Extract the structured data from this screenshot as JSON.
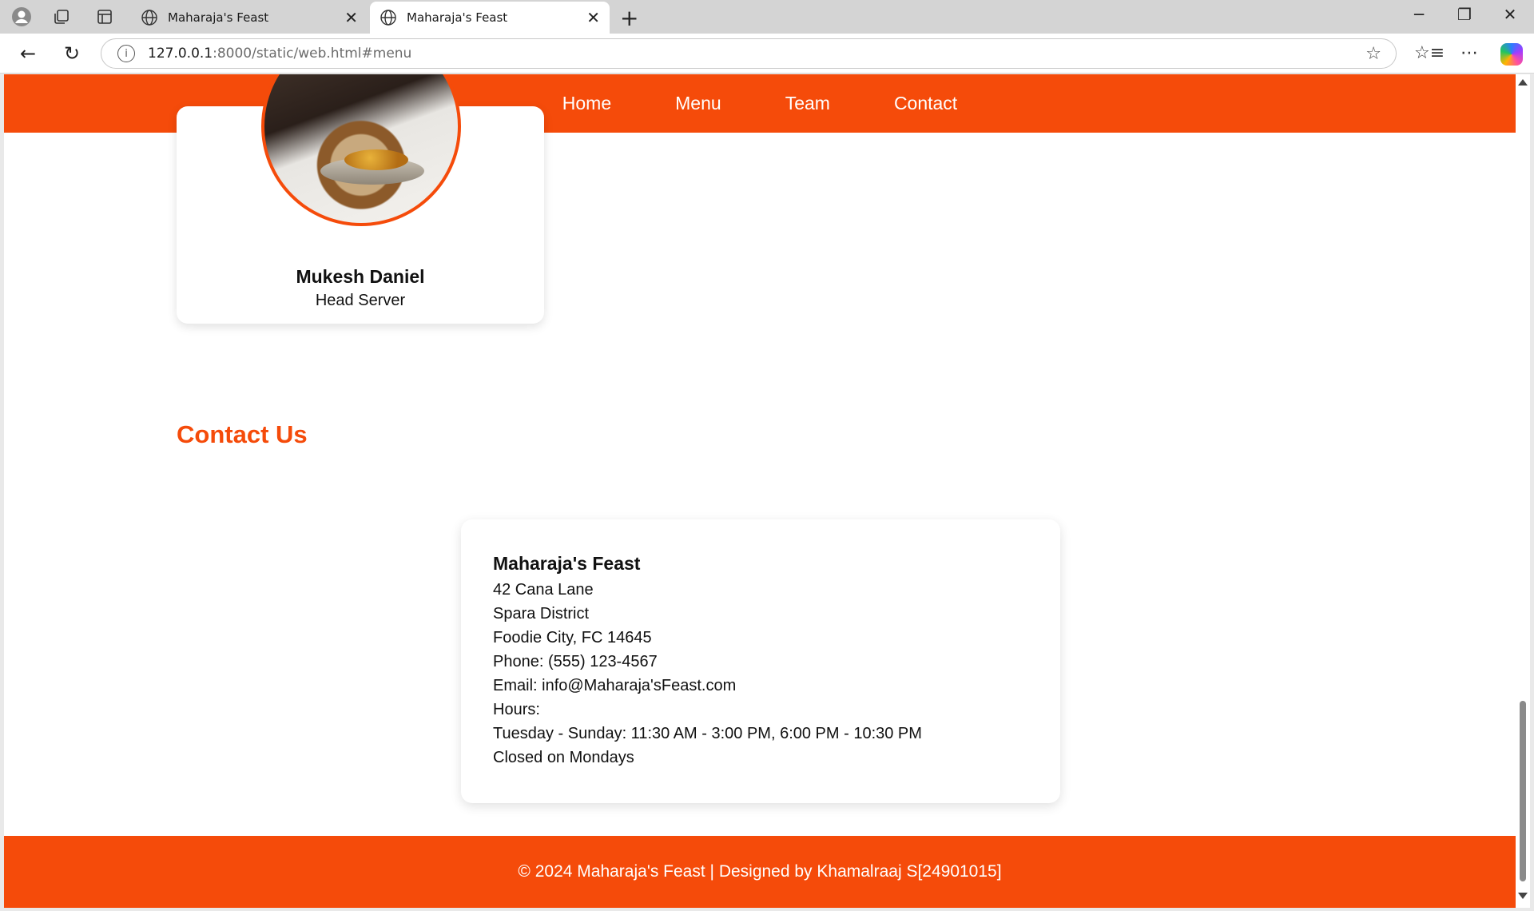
{
  "browser": {
    "tabs": [
      {
        "title": "Maharaja's Feast",
        "active": false
      },
      {
        "title": "Maharaja's Feast",
        "active": true
      }
    ],
    "url_host": "127.0.0.1",
    "url_path": ":8000/static/web.html#menu",
    "icons": {
      "profile": "profile-icon",
      "collections": "collections-icon",
      "tab_actions": "tab-actions-icon",
      "new_tab": "+",
      "minimize": "─",
      "restore": "❐",
      "close": "✕",
      "back": "←",
      "refresh": "↻",
      "favorite": "☆",
      "favorites": "☆≡",
      "more": "⋯"
    }
  },
  "site": {
    "nav": [
      "Home",
      "Menu",
      "Team",
      "Contact"
    ],
    "team_member": {
      "name": "Mukesh Daniel",
      "role": "Head Server"
    },
    "contact_heading": "Contact Us",
    "contact": {
      "business_name": "Maharaja's Feast",
      "lines": [
        "42 Cana Lane",
        "Spara District",
        "Foodie City, FC 14645",
        "Phone: (555) 123-4567",
        "Email: info@Maharaja'sFeast.com",
        "Hours:",
        "Tuesday - Sunday: 11:30 AM - 3:00 PM, 6:00 PM - 10:30 PM",
        "Closed on Mondays"
      ]
    },
    "footer": "© 2024 Maharaja's Feast | Designed by Khamalraaj S[24901015]"
  },
  "colors": {
    "brand": "#f54b0a",
    "text": "#111111"
  }
}
